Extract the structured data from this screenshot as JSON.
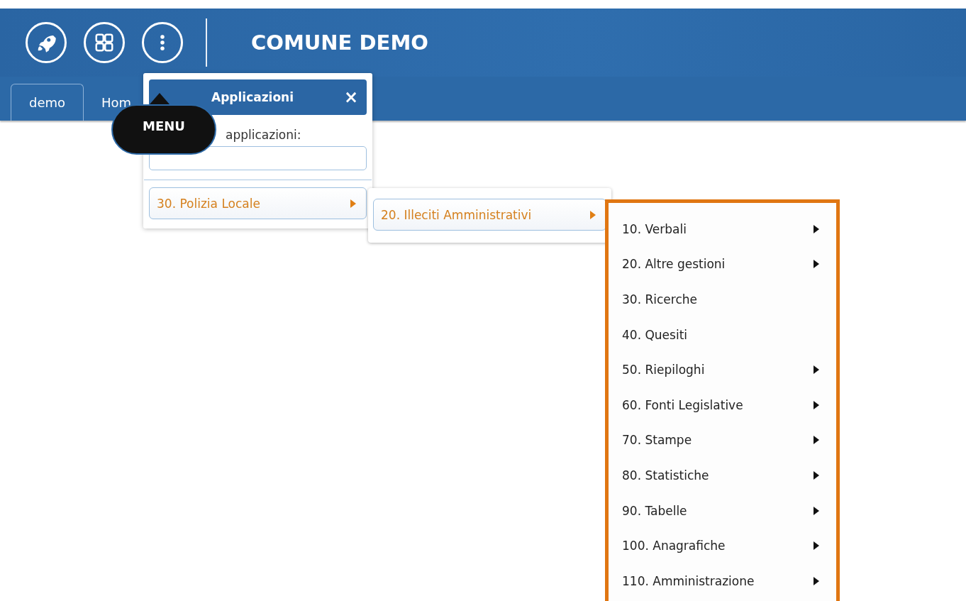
{
  "header": {
    "title": "COMUNE DEMO"
  },
  "tabs": [
    {
      "label": "demo",
      "selected": true
    },
    {
      "label": "Hom",
      "selected": false
    }
  ],
  "tooltip": {
    "text": "MENU"
  },
  "apps_panel": {
    "title": "Applicazioni",
    "close": "×",
    "search_label": "applicazioni:",
    "items": [
      {
        "label": "30. Polizia Locale",
        "selected": true,
        "submenu": true
      }
    ]
  },
  "submenu": {
    "items": [
      {
        "label": "20. Illeciti Amministrativi",
        "selected": true,
        "submenu": true
      }
    ]
  },
  "submenu_2": {
    "items": [
      {
        "label": "10. Verbali",
        "submenu": true
      },
      {
        "label": "20. Altre gestioni",
        "submenu": true
      },
      {
        "label": "30. Ricerche",
        "submenu": false
      },
      {
        "label": "40. Quesiti",
        "submenu": false
      },
      {
        "label": "50. Riepiloghi",
        "submenu": true
      },
      {
        "label": "60. Fonti Legislative",
        "submenu": true
      },
      {
        "label": "70. Stampe",
        "submenu": true
      },
      {
        "label": "80. Statistiche",
        "submenu": true
      },
      {
        "label": "90. Tabelle",
        "submenu": true
      },
      {
        "label": "100. Anagrafiche",
        "submenu": true
      },
      {
        "label": "110. Amministrazione",
        "submenu": true
      }
    ]
  }
}
